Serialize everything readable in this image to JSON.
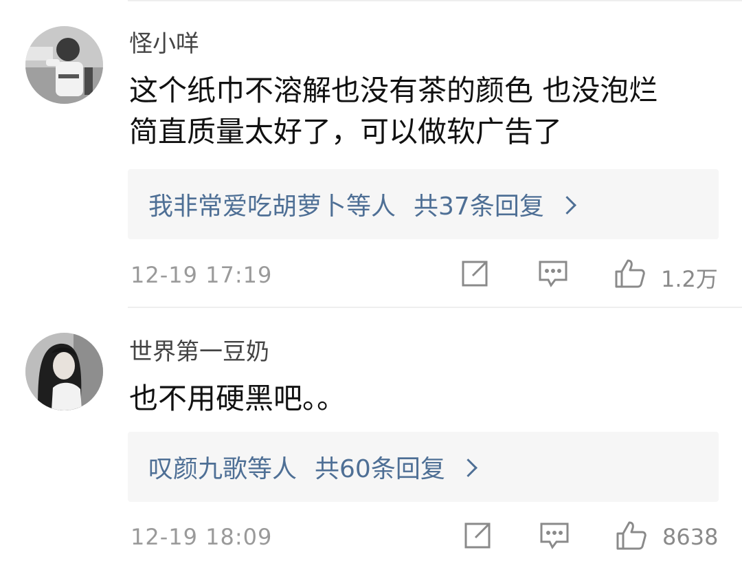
{
  "comments": [
    {
      "username": "怪小咩",
      "text_line1": "这个纸巾不溶解也没有茶的颜色 也没泡烂",
      "text_line2": "简直质量太好了，可以做软广告了",
      "reply_users": "我非常爱吃胡萝卜等人",
      "reply_count": "共37条回复",
      "timestamp": "12-19 17:19",
      "likes": "1.2万"
    },
    {
      "username": "世界第一豆奶",
      "text_line1": "也不用硬黑吧。。",
      "reply_users": "叹颜九歌等人",
      "reply_count": "共60条回复",
      "timestamp": "12-19 18:09",
      "likes": "8638"
    }
  ],
  "icons": {
    "share": "share-icon",
    "comment": "comment-icon",
    "like": "thumbs-up-icon",
    "reply_chevron": "chevron-right-icon"
  },
  "colors": {
    "link_blue": "#4e6f95",
    "meta_gray": "#9a9a9a",
    "reply_bg": "#f6f6f6"
  }
}
